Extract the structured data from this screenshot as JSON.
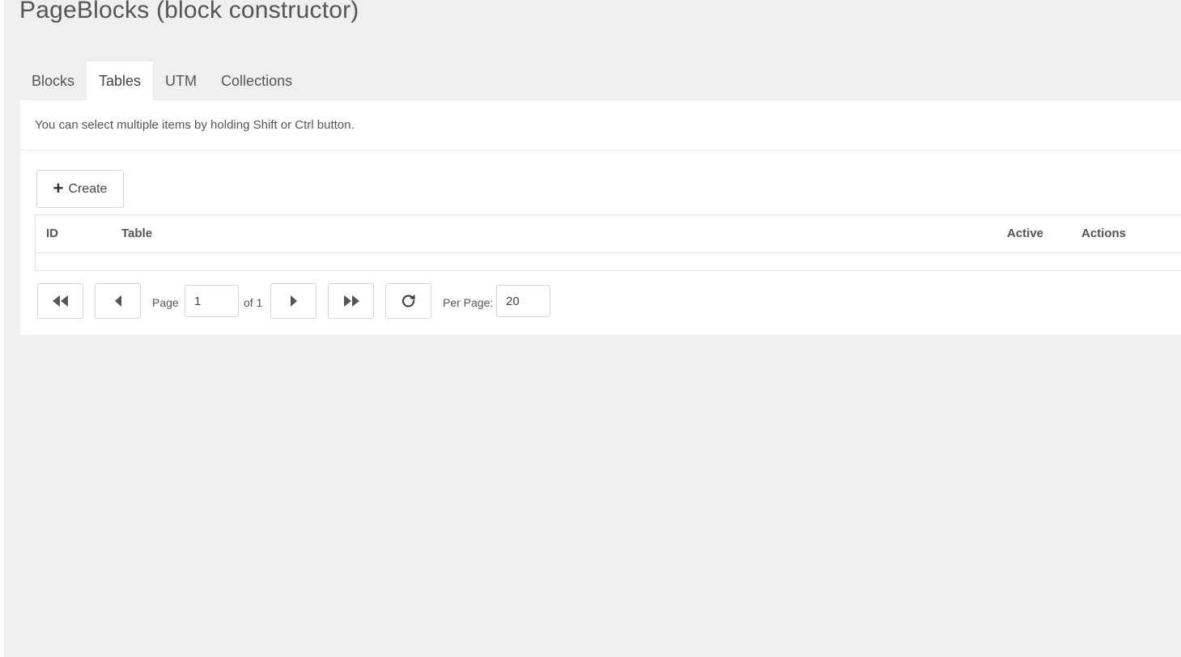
{
  "page": {
    "title": "PageBlocks (block constructor)"
  },
  "tabs": [
    {
      "label": "Blocks",
      "active": false
    },
    {
      "label": "Tables",
      "active": true
    },
    {
      "label": "UTM",
      "active": false
    },
    {
      "label": "Collections",
      "active": false
    }
  ],
  "panel": {
    "hint": "You can select multiple items by holding Shift or Ctrl button.",
    "create_label": "Create",
    "create_icon": "plus-icon"
  },
  "grid": {
    "columns": [
      "ID",
      "Table",
      "Active",
      "Actions"
    ],
    "rows": []
  },
  "pager": {
    "page_label": "Page",
    "page_value": "1",
    "of_label": "of 1",
    "per_page_label": "Per Page:",
    "per_page_value": "20",
    "icons": {
      "first": "double-chevron-left-icon",
      "prev": "triangle-left-icon",
      "next": "triangle-right-icon",
      "last": "double-chevron-right-icon",
      "refresh": "refresh-icon"
    }
  }
}
